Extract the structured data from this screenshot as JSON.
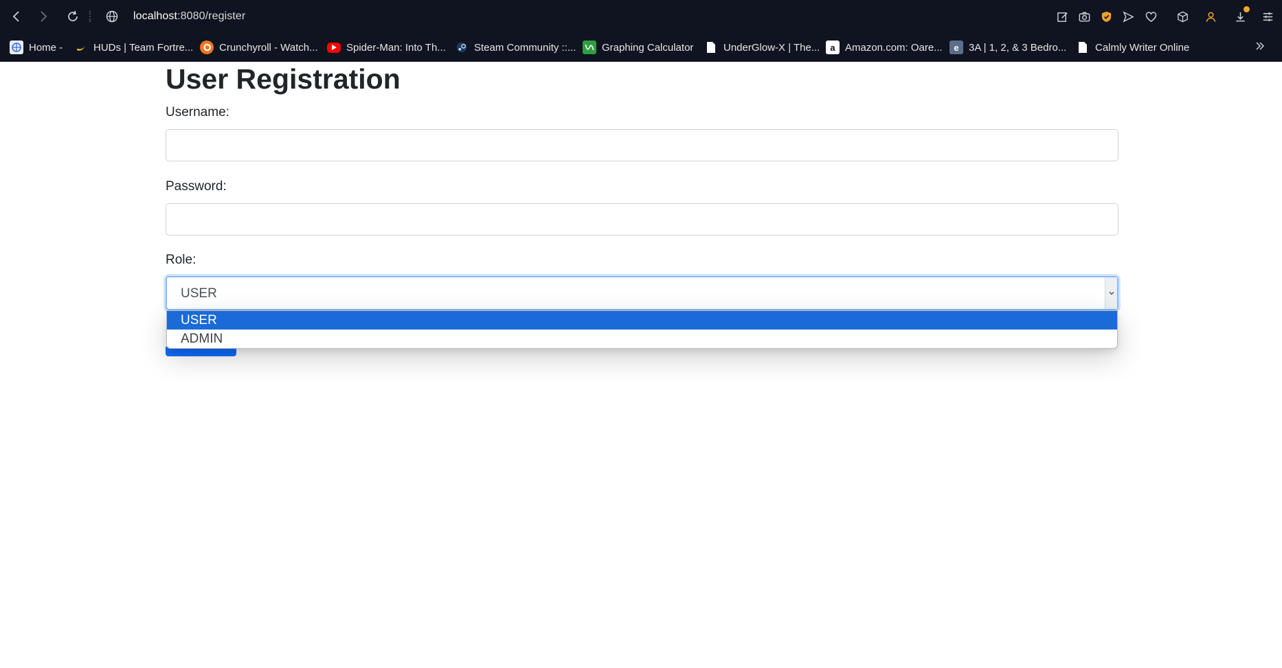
{
  "browser": {
    "url_host": "localhost",
    "url_path": ":8080/register",
    "bookmarks": [
      {
        "label": "Home -",
        "icon": "globe-icon",
        "color": "#3b6fd6"
      },
      {
        "label": "HUDs | Team Fortre...",
        "icon": "banana-icon",
        "color": "#f1c232"
      },
      {
        "label": "Crunchyroll - Watch...",
        "icon": "crunchyroll-icon",
        "color": "#f47521"
      },
      {
        "label": "Spider-Man: Into Th...",
        "icon": "youtube-icon",
        "color": "#ff0000"
      },
      {
        "label": "Steam Community ::...",
        "icon": "steam-icon",
        "color": "#2a6ea8"
      },
      {
        "label": "Graphing Calculator",
        "icon": "desmos-icon",
        "color": "#2e9e3f"
      },
      {
        "label": "UnderGlow-X | The...",
        "icon": "page-icon",
        "color": "#ffffff"
      },
      {
        "label": "Amazon.com: Oare...",
        "icon": "amazon-icon",
        "color": "#ffffff"
      },
      {
        "label": "3A | 1, 2, & 3 Bedro...",
        "icon": "e-icon",
        "color": "#5a6e8c"
      },
      {
        "label": "Calmly Writer Online",
        "icon": "page-icon",
        "color": "#ffffff"
      }
    ]
  },
  "page": {
    "title": "User Registration",
    "username_label": "Username:",
    "username_value": "",
    "password_label": "Password:",
    "password_value": "",
    "role_label": "Role:",
    "role_value": "USER",
    "role_options": [
      "USER",
      "ADMIN"
    ],
    "role_selected_index": 0
  },
  "colors": {
    "chrome_bg": "#0f1420",
    "accent": "#0d6efd",
    "option_highlight": "#1a6bd8",
    "notification_dot": "#f5a623"
  }
}
